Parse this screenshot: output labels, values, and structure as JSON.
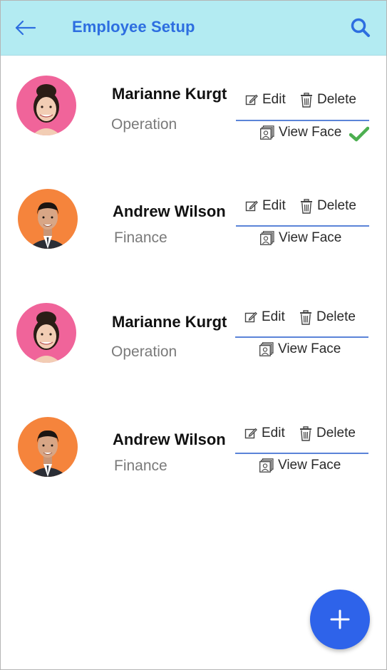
{
  "header": {
    "title": "Employee Setup",
    "back_icon": "arrow-left-icon",
    "search_icon": "search-icon",
    "background": "#b3ebf2",
    "accent": "#2d6ee0"
  },
  "employees": [
    {
      "name": "Marianne Kurgt",
      "department": "Operation",
      "edit_label": "Edit",
      "delete_label": "Delete",
      "view_face_label": "View Face",
      "face_registered": true,
      "avatar_bg": "#f0649a"
    },
    {
      "name": "Andrew Wilson",
      "department": "Finance",
      "edit_label": "Edit",
      "delete_label": "Delete",
      "view_face_label": "View Face",
      "face_registered": false,
      "avatar_bg": "#f5843c"
    },
    {
      "name": "Marianne Kurgt",
      "department": "Operation",
      "edit_label": "Edit",
      "delete_label": "Delete",
      "view_face_label": "View Face",
      "face_registered": false,
      "avatar_bg": "#f0649a"
    },
    {
      "name": "Andrew Wilson",
      "department": "Finance",
      "edit_label": "Edit",
      "delete_label": "Delete",
      "view_face_label": "View Face",
      "face_registered": false,
      "avatar_bg": "#f5843c"
    }
  ],
  "fab": {
    "icon": "plus-icon",
    "color": "#2e63ea"
  },
  "status_colors": {
    "registered": "#4caf50"
  }
}
